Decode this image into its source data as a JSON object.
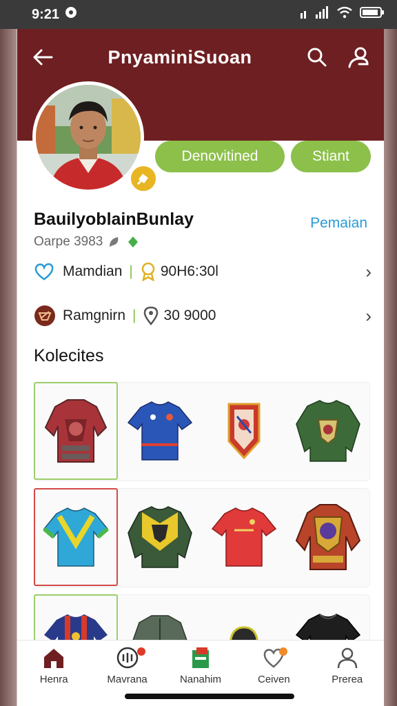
{
  "status": {
    "time": "9:21"
  },
  "header": {
    "title": "PnyaminiSuoan",
    "back_icon": "arrow-left-icon",
    "search_icon": "search-icon",
    "profile_icon": "user-icon",
    "color": "#6e1f22"
  },
  "actions": {
    "primary": "Denovitined",
    "secondary": "Stiant",
    "accent": "#8cc04b"
  },
  "profile": {
    "name": "BauilyoblainBunlay",
    "link": "Pemaian",
    "sub": "Oarpe 3983"
  },
  "rows": [
    {
      "label": "Mamdian",
      "value": "90H6:30l"
    },
    {
      "label": "Ramgnirn",
      "value": "30 9000"
    }
  ],
  "section": {
    "title": "Kolecites"
  },
  "nav": [
    {
      "label": "Henra",
      "icon": "home-icon",
      "active": true
    },
    {
      "label": "Mavrana",
      "icon": "bell-icon"
    },
    {
      "label": "Nanahim",
      "icon": "book-icon"
    },
    {
      "label": "Ceiven",
      "icon": "heart-icon"
    },
    {
      "label": "Prerea",
      "icon": "user-icon"
    }
  ]
}
